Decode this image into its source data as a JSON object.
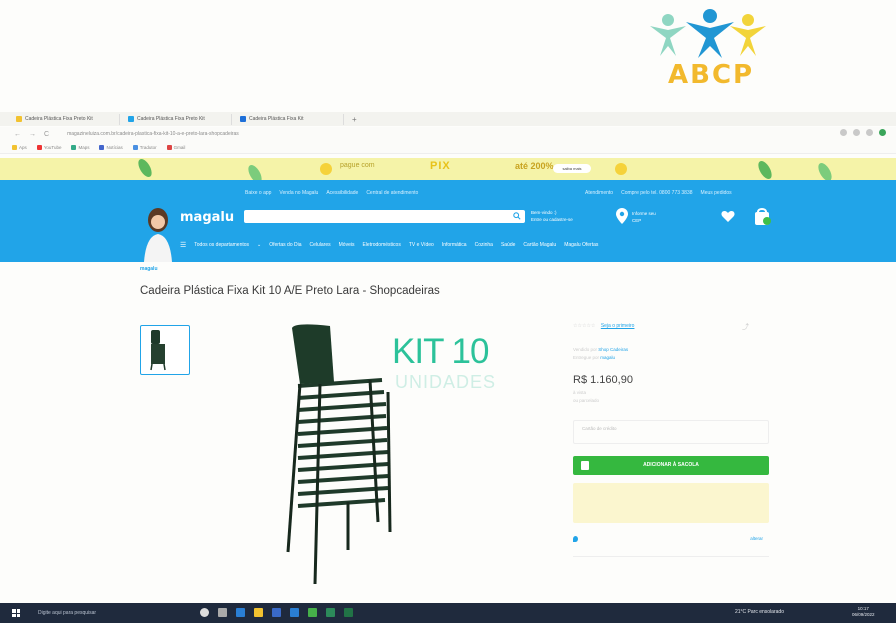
{
  "logo": {
    "text": "ABCP",
    "colors": [
      "#8fd6c2",
      "#2196d3",
      "#f2d43a"
    ]
  },
  "browser": {
    "tabs": [
      {
        "label": "Cadeira Plástica Fixa Preto Kit"
      },
      {
        "label": "Cadeira Plástica Fixa Preto Kit"
      },
      {
        "label": "Cadeira Plástica Fixa Kit"
      }
    ],
    "new_tab": "+",
    "back": "←",
    "forward": "→",
    "reload": "C",
    "url": "magazineluiza.com.br/cadeira-plastica-fixa-kit-10-a-e-preto-lara-shopcadeiras",
    "bookmarks": [
      "Aps",
      "YouTube",
      "Maps",
      "Notícias",
      "Tradutor",
      "Gmail"
    ]
  },
  "promo": {
    "left_text": "pague com",
    "highlight": "PIX",
    "amount": "até 200%",
    "button": "saiba mais"
  },
  "header": {
    "top_links": [
      "Baixe o app",
      "Venda no Magalu",
      "Acessibilidade",
      "Central de atendimento"
    ],
    "top_links_right": [
      "Atendimento",
      "Compre pelo tel. 0800 773 3838",
      "Meus pedidos"
    ],
    "brand": "magalu",
    "search_placeholder": "",
    "login_line1": "Bem-vindo :)",
    "login_line2": "Entre ou cadastre-se",
    "cep_line1": "Informe seu",
    "cep_line2": "CEP",
    "menu_label": "Todos os departamentos",
    "menu": [
      "Ofertas do Dia",
      "Celulares",
      "Móveis",
      "Eletrodomésticos",
      "TV e Vídeo",
      "Informática",
      "Cozinha",
      "Saúde",
      "Cartão Magalu",
      "Magalu Ofertas"
    ]
  },
  "product": {
    "crumb": "magalu",
    "crumb_rest": "",
    "title": "Cadeira Plástica Fixa Kit 10 A/E Preto Lara - Shopcadeiras",
    "kit_text": "KIT 10",
    "kit_sub": "UNIDADES"
  },
  "buybox": {
    "rating_link": "Seja o primeiro",
    "share": "⤴",
    "seller_line1_label": "Vendido por",
    "seller_line1_value": "Shop Cadeiras",
    "seller_line2_label": "Entregue por",
    "seller_line2_value": "magalu",
    "price": "R$ 1.160,90",
    "price_sub1": "à vista",
    "price_sub2": "ou parcelado",
    "card_label": "Cartão de crédito",
    "card_sub": "",
    "card_right1": "",
    "card_right2": "",
    "add_button": "ADICIONAR À SACOLA",
    "notice": "",
    "ship_text": "",
    "ship_link": "alterar",
    "ship2_line1": "",
    "ship2_line2": "",
    "ship2_price": ""
  },
  "taskbar": {
    "search": "Digite aqui para pesquisar",
    "tray": "21°C Parc ensolarado",
    "time": "10:17",
    "date": "06/09/2022"
  }
}
